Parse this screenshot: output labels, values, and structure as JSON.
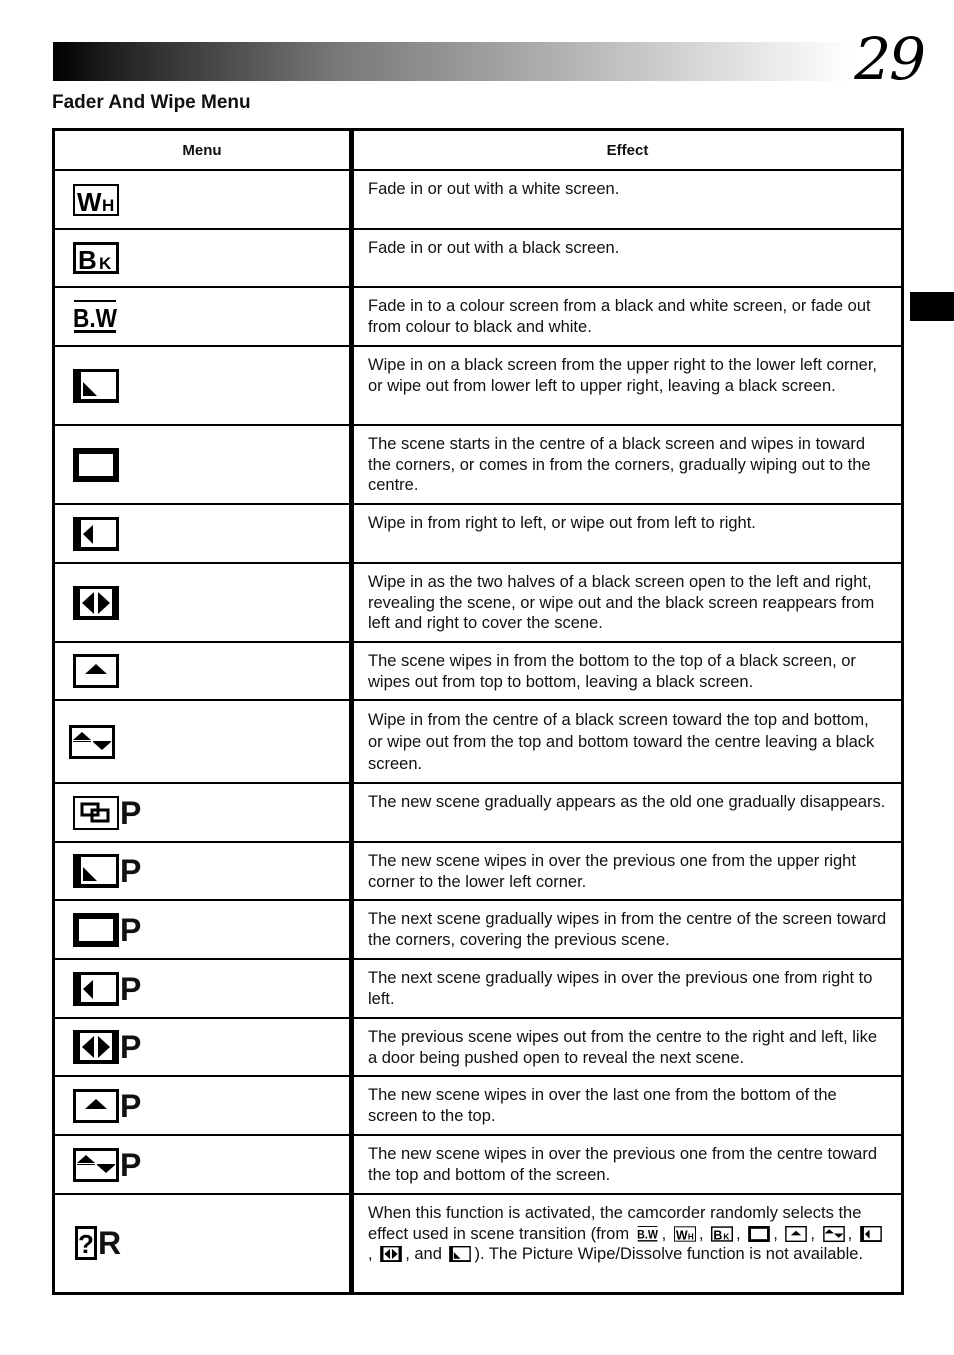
{
  "page": {
    "number": "29",
    "section_title": "Fader And Wipe Menu"
  },
  "table": {
    "headers": {
      "menu": "Menu",
      "effect": "Effect"
    },
    "rows": [
      {
        "icon": "fade-white-icon",
        "label": "WH",
        "effect": "Fade in or out with a white screen."
      },
      {
        "icon": "fade-black-icon",
        "label": "BK",
        "effect": "Fade in or out with a black screen."
      },
      {
        "icon": "fade-bw-icon",
        "label": "B.W",
        "effect": "Fade in to a colour screen from a black and white screen, or fade out from colour to black and white."
      },
      {
        "icon": "corner-wipe-icon",
        "label": "",
        "effect": "Wipe in on a black screen from the upper right to the lower left corner, or wipe out from lower left to upper right, leaving a black screen."
      },
      {
        "icon": "window-wipe-icon",
        "label": "",
        "effect": "The scene starts in the centre of a black screen and wipes in toward the corners, or comes in from the corners, gradually wiping out to the centre."
      },
      {
        "icon": "slide-wipe-icon",
        "label": "",
        "effect": "Wipe in from right to left, or wipe out from left to right."
      },
      {
        "icon": "door-wipe-icon",
        "label": "",
        "effect": "Wipe in as the two halves of a black screen open to the left and right, revealing the scene, or wipe out and the black screen reappears from left and right to cover the scene."
      },
      {
        "icon": "scroll-wipe-icon",
        "label": "",
        "effect": "The scene wipes in from the bottom to the top of a black screen, or wipes out from top to bottom, leaving a black screen."
      },
      {
        "icon": "shutter-wipe-icon",
        "label": "",
        "effect": "Wipe in from the centre of a black screen toward the top and bottom, or wipe out from the top and bottom toward the centre leaving a black screen."
      },
      {
        "icon": "dissolve-icon",
        "label": "P",
        "effect": "The new scene gradually appears as the old one gradually disappears."
      },
      {
        "icon": "corner-wipe-icon",
        "label": "P",
        "effect": "The new scene wipes in over the previous one from the upper right corner to the lower left corner."
      },
      {
        "icon": "window-wipe-icon",
        "label": "P",
        "effect": "The next scene gradually wipes in from the centre of the screen toward the corners, covering the previous scene."
      },
      {
        "icon": "slide-wipe-icon",
        "label": "P",
        "effect": "The next scene gradually wipes in over the previous one from right to left."
      },
      {
        "icon": "door-wipe-icon",
        "label": "P",
        "effect": "The previous scene wipes out from the centre to the right and left, like a door being pushed open to reveal the next scene."
      },
      {
        "icon": "scroll-wipe-icon",
        "label": "P",
        "effect": "The new scene wipes in over the last one from the bottom of the screen to the top."
      },
      {
        "icon": "shutter-wipe-icon",
        "label": "P",
        "effect": "The new scene wipes in over the previous one from the centre toward the top and bottom of the screen."
      },
      {
        "icon": "random-icon",
        "label": "R",
        "effect_parts": {
          "before": "When this function is activated, the camcorder randomly selects the effect used in scene transition (from",
          "sep": ",",
          "and": ", and",
          "after": "). The Picture Wipe/Dissolve function is not available."
        }
      }
    ]
  }
}
